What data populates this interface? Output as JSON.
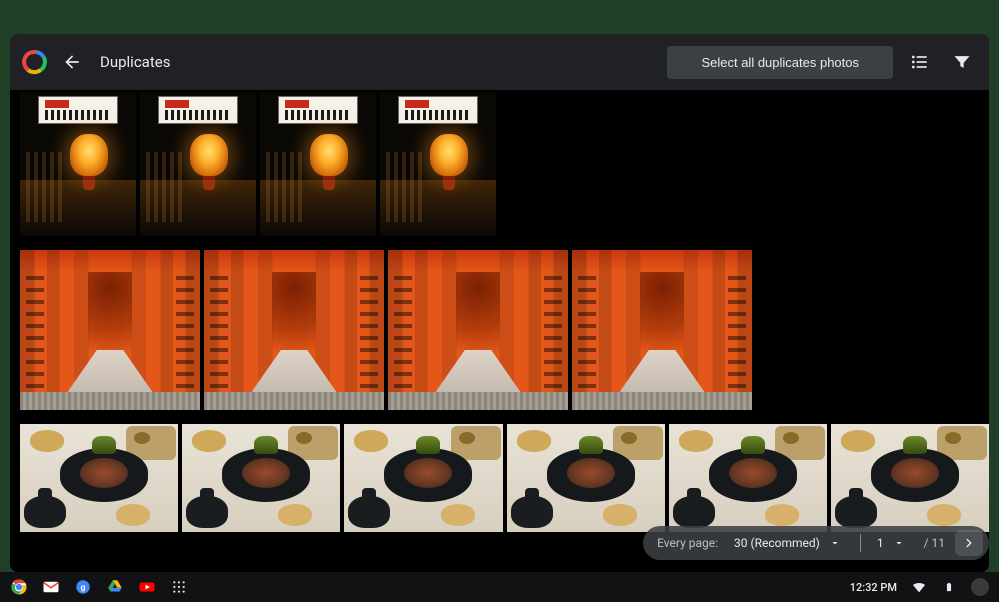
{
  "header": {
    "title": "Duplicates",
    "select_all_label": "Select all duplicates photos"
  },
  "groups": [
    {
      "kind": "lantern",
      "count": 4
    },
    {
      "kind": "torii",
      "count": 4
    },
    {
      "kind": "food",
      "count": 6
    }
  ],
  "pager": {
    "every_page_label": "Every page:",
    "page_size": "30 (Recommed)",
    "current_page": "1",
    "total_pages": "11"
  },
  "taskbar": {
    "clock": "12:32 PM"
  }
}
